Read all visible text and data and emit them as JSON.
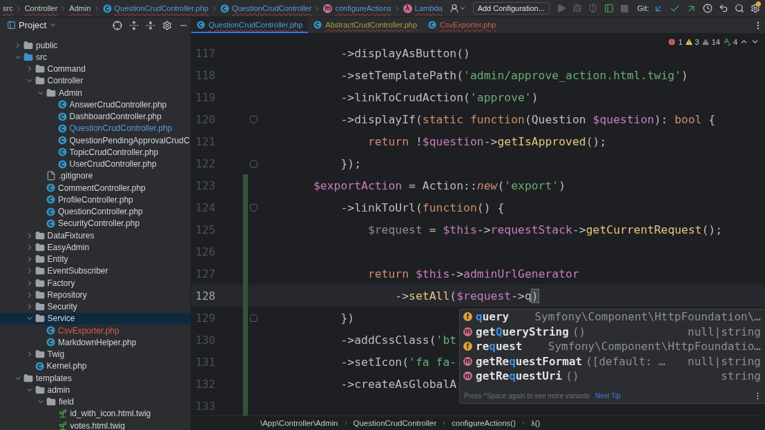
{
  "navbar": {
    "breadcrumbs": [
      {
        "label": "src",
        "kind": "plain"
      },
      {
        "label": "Controller",
        "kind": "plain"
      },
      {
        "label": "Admin",
        "kind": "plain"
      },
      {
        "label": "QuestionCrudController.php",
        "kind": "class"
      },
      {
        "label": "QuestionCrudController",
        "kind": "class"
      },
      {
        "label": "configureActions",
        "kind": "method",
        "badge": "m"
      },
      {
        "label": "Lambda",
        "kind": "lambda",
        "badge": "λ"
      }
    ],
    "run_config": "Add Configuration...",
    "git_label": "Git:"
  },
  "project_panel": {
    "title": "Project"
  },
  "tabs": [
    {
      "label": "QuestionCrudController.php",
      "selected": true,
      "color": "#4f9fd6"
    },
    {
      "label": "AbstractCrudController.php",
      "selected": false,
      "color": "#a9a23a"
    },
    {
      "label": "CsvExporter.php",
      "selected": false,
      "color": "#d65a55"
    }
  ],
  "inspections": {
    "errors": "1",
    "warnings": "3",
    "weak_warnings": "14",
    "typos": "4"
  },
  "tree": [
    {
      "label": "public",
      "kind": "folder",
      "expanded": false,
      "selected": false
    },
    {
      "label": "src",
      "kind": "folder",
      "expanded": true,
      "selected": false,
      "source_root": true,
      "children": [
        {
          "label": "Command",
          "kind": "folder",
          "expanded": false,
          "selected": false
        },
        {
          "label": "Controller",
          "kind": "folder",
          "expanded": true,
          "selected": false,
          "children": [
            {
              "label": "Admin",
              "kind": "folder",
              "expanded": true,
              "selected": false,
              "children": [
                {
                  "label": "AnswerCrudController.php",
                  "kind": "php",
                  "selected": false
                },
                {
                  "label": "DashboardController.php",
                  "kind": "php",
                  "selected": false
                },
                {
                  "label": "QuestionCrudController.php",
                  "kind": "php",
                  "selected": false,
                  "color": "#5a9bd6"
                },
                {
                  "label": "QuestionPendingApprovalCrudC",
                  "kind": "php",
                  "selected": false
                },
                {
                  "label": "TopicCrudController.php",
                  "kind": "php",
                  "selected": false
                },
                {
                  "label": "UserCrudController.php",
                  "kind": "php",
                  "selected": false
                }
              ]
            },
            {
              "label": ".gitignore",
              "kind": "ignore",
              "selected": false
            },
            {
              "label": "CommentController.php",
              "kind": "php",
              "selected": false
            },
            {
              "label": "ProfileController.php",
              "kind": "php",
              "selected": false
            },
            {
              "label": "QuestionController.php",
              "kind": "php",
              "selected": false
            },
            {
              "label": "SecurityController.php",
              "kind": "php",
              "selected": false
            }
          ]
        },
        {
          "label": "DataFixtures",
          "kind": "folder",
          "expanded": false,
          "selected": false
        },
        {
          "label": "EasyAdmin",
          "kind": "folder",
          "expanded": false,
          "selected": false
        },
        {
          "label": "Entity",
          "kind": "folder",
          "expanded": false,
          "selected": false
        },
        {
          "label": "EventSubscriber",
          "kind": "folder",
          "expanded": false,
          "selected": false
        },
        {
          "label": "Factory",
          "kind": "folder",
          "expanded": false,
          "selected": false
        },
        {
          "label": "Repository",
          "kind": "folder",
          "expanded": false,
          "selected": false
        },
        {
          "label": "Security",
          "kind": "folder",
          "expanded": false,
          "selected": false
        },
        {
          "label": "Service",
          "kind": "folder",
          "expanded": true,
          "selected": true,
          "children": [
            {
              "label": "CsvExporter.php",
              "kind": "php",
              "selected": false,
              "color": "#d65a55"
            },
            {
              "label": "MarkdownHelper.php",
              "kind": "php",
              "selected": false
            }
          ]
        },
        {
          "label": "Twig",
          "kind": "folder",
          "expanded": false,
          "selected": false
        },
        {
          "label": "Kernel.php",
          "kind": "php",
          "selected": false
        }
      ]
    },
    {
      "label": "templates",
      "kind": "folder",
      "expanded": true,
      "selected": false,
      "children": [
        {
          "label": "admin",
          "kind": "folder",
          "expanded": true,
          "selected": false,
          "children": [
            {
              "label": "field",
              "kind": "folder",
              "expanded": true,
              "selected": false,
              "children": [
                {
                  "label": "id_with_icon.html.twig",
                  "kind": "twig",
                  "selected": false
                },
                {
                  "label": "votes.html.twig",
                  "kind": "twig",
                  "selected": false
                }
              ]
            }
          ]
        }
      ]
    }
  ],
  "code_lines": [
    {
      "number": "117",
      "changed": false,
      "current": false,
      "tokens": [
        {
          "text": "            ->displayAsButton()",
          "kind": "plain"
        }
      ]
    },
    {
      "number": "118",
      "changed": false,
      "current": false,
      "tokens": [
        {
          "text": "            ->setTemplatePath(",
          "kind": "plain"
        },
        {
          "text": "'admin/approve_action.html.twig'",
          "kind": "str"
        },
        {
          "text": ")",
          "kind": "plain"
        }
      ]
    },
    {
      "number": "119",
      "changed": false,
      "current": false,
      "tokens": [
        {
          "text": "            ->linkToCrudAction(",
          "kind": "plain"
        },
        {
          "text": "'approve'",
          "kind": "str"
        },
        {
          "text": ")",
          "kind": "plain"
        }
      ]
    },
    {
      "number": "120",
      "changed": false,
      "current": false,
      "fold_start": true,
      "tokens": [
        {
          "text": "            ->displayIf(",
          "kind": "plain"
        },
        {
          "text": "static function",
          "kind": "kw"
        },
        {
          "text": "(Question ",
          "kind": "plain"
        },
        {
          "text": "$question",
          "kind": "var"
        },
        {
          "text": "): ",
          "kind": "plain"
        },
        {
          "text": "bool",
          "kind": "kw"
        },
        {
          "text": " {",
          "kind": "plain"
        }
      ]
    },
    {
      "number": "121",
      "changed": false,
      "current": false,
      "tokens": [
        {
          "text": "                return",
          "kind": "kw"
        },
        {
          "text": " !",
          "kind": "plain"
        },
        {
          "text": "$question",
          "kind": "var"
        },
        {
          "text": "->",
          "kind": "plain"
        },
        {
          "text": "getIsApproved",
          "kind": "call"
        },
        {
          "text": "();",
          "kind": "plain"
        }
      ]
    },
    {
      "number": "122",
      "changed": false,
      "current": false,
      "fold_end": true,
      "tokens": [
        {
          "text": "            });",
          "kind": "plain"
        }
      ]
    },
    {
      "number": "123",
      "changed": true,
      "current": false,
      "tokens": [
        {
          "text": "        $exportAction",
          "kind": "var"
        },
        {
          "text": " = Action::",
          "kind": "plain"
        },
        {
          "text": "new",
          "kind": "kwi"
        },
        {
          "text": "(",
          "kind": "plain"
        },
        {
          "text": "'export'",
          "kind": "str"
        },
        {
          "text": ")",
          "kind": "plain"
        }
      ]
    },
    {
      "number": "124",
      "changed": true,
      "current": false,
      "fold_start": true,
      "tokens": [
        {
          "text": "            ->linkToUrl(",
          "kind": "plain"
        },
        {
          "text": "function",
          "kind": "kw"
        },
        {
          "text": "() {",
          "kind": "plain"
        }
      ]
    },
    {
      "number": "125",
      "changed": true,
      "current": false,
      "tokens": [
        {
          "text": "                $request",
          "kind": "muted"
        },
        {
          "text": " = ",
          "kind": "plain"
        },
        {
          "text": "$this",
          "kind": "var"
        },
        {
          "text": "->",
          "kind": "plain"
        },
        {
          "text": "requestStack",
          "kind": "var"
        },
        {
          "text": "->",
          "kind": "plain"
        },
        {
          "text": "getCurrentRequest",
          "kind": "call"
        },
        {
          "text": "();",
          "kind": "plain"
        }
      ]
    },
    {
      "number": "126",
      "changed": true,
      "current": false
    },
    {
      "number": "127",
      "changed": true,
      "current": false,
      "tokens": [
        {
          "text": "                return",
          "kind": "kw"
        },
        {
          "text": " $this",
          "kind": "var"
        },
        {
          "text": "->",
          "kind": "plain"
        },
        {
          "text": "adminUrlGenerator",
          "kind": "var"
        }
      ]
    },
    {
      "number": "128",
      "changed": true,
      "current": true,
      "tokens": [
        {
          "text": "                    ->",
          "kind": "plain"
        },
        {
          "text": "setAll",
          "kind": "call"
        },
        {
          "text": "(",
          "kind": "plain"
        },
        {
          "text": "$request",
          "kind": "var"
        },
        {
          "text": "->q",
          "kind": "plain"
        },
        {
          "text": ")",
          "kind": "bracket"
        }
      ]
    },
    {
      "number": "129",
      "changed": true,
      "current": false,
      "fold_end": true,
      "tokens": [
        {
          "text": "            })",
          "kind": "plain"
        }
      ]
    },
    {
      "number": "130",
      "changed": true,
      "current": false,
      "tokens": [
        {
          "text": "            ->addCssClass(",
          "kind": "plain"
        },
        {
          "text": "'bt",
          "kind": "str"
        }
      ]
    },
    {
      "number": "131",
      "changed": true,
      "current": false,
      "tokens": [
        {
          "text": "            ->setIcon(",
          "kind": "plain"
        },
        {
          "text": "'fa fa-",
          "kind": "str"
        }
      ]
    },
    {
      "number": "132",
      "changed": true,
      "current": false,
      "tokens": [
        {
          "text": "            ->createAsGlobalA",
          "kind": "plain"
        }
      ]
    },
    {
      "number": "133",
      "changed": true,
      "current": false
    }
  ],
  "completion": {
    "items": [
      {
        "kind": "field",
        "badge": "f",
        "match": "q",
        "after": "uery",
        "type": "Symfony\\Component\\HttpFoundation\\…"
      },
      {
        "kind": "method",
        "badge": "m",
        "before": "get",
        "match": "Q",
        "after": "ueryString",
        "params": "()",
        "type": "null|string"
      },
      {
        "kind": "field",
        "badge": "f",
        "before": "re",
        "match": "q",
        "after": "uest",
        "type": "Symfony\\Component\\HttpFoundatio…"
      },
      {
        "kind": "method",
        "badge": "m",
        "before": "getRe",
        "match": "q",
        "after": "uestFormat",
        "params": "([default: …",
        "type": "null|string"
      },
      {
        "kind": "method",
        "badge": "m",
        "before": "getRe",
        "match": "q",
        "after": "uestUri",
        "params": "()",
        "type": "string"
      }
    ],
    "hint": "Press ^Space again to see more variants",
    "link": "Next Tip"
  },
  "breadcrumbs": [
    "\\App\\Controller\\Admin",
    "QuestionCrudController",
    "configureActions()",
    "λ()"
  ]
}
